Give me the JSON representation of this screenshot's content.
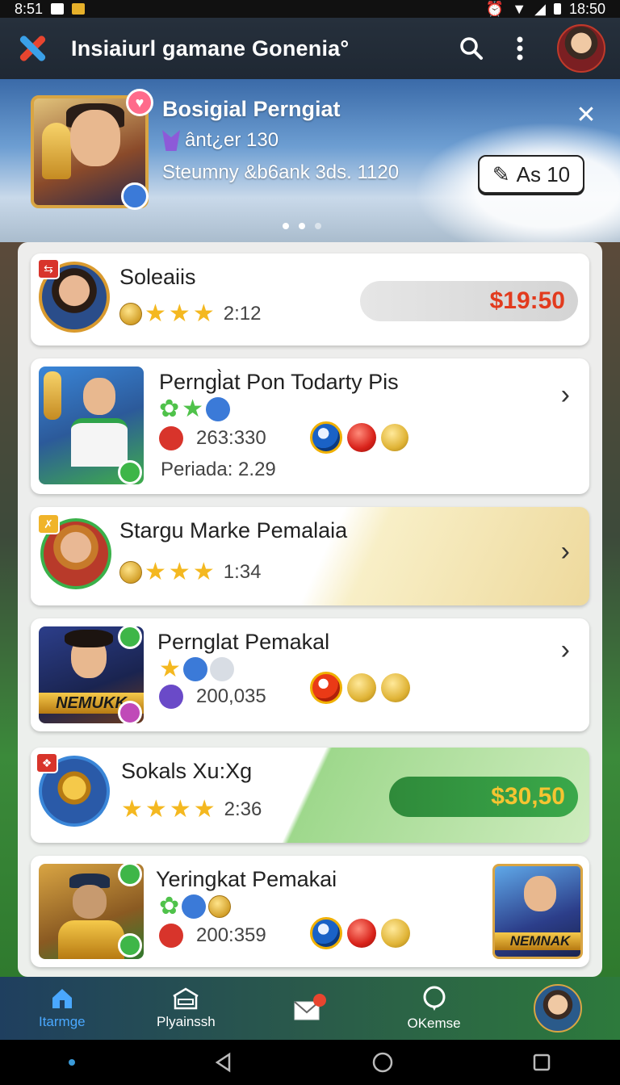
{
  "status": {
    "time_left": "8:51",
    "time_right": "18:50"
  },
  "appbar": {
    "title": "Insiaiurl gamane Gonenia°"
  },
  "hero": {
    "title": "Bosigial Perngiat",
    "subtitle": "ânt¿er 130",
    "meta": "Steumny &b6ank 3ds. 1120",
    "button_label": "As 10",
    "page_count": 3,
    "active_page": 2
  },
  "items": [
    {
      "title": "Soleaiis",
      "time": "2:12",
      "price": "$19:50",
      "price_color": "#e23b1e"
    },
    {
      "title": "Perngl̀at Pon Todarty Pis",
      "stat": "263:330",
      "extra": "Periada: 2.29"
    },
    {
      "title": "Stargu Marke Pemalaia",
      "time": "1:34"
    },
    {
      "title": "Pernglat Pemakal",
      "stat": "200,035",
      "card_text": "NEMUKK"
    },
    {
      "title": "Sokals Xu:Xg",
      "time": "2:36",
      "price": "$30,50",
      "price_color": "#2f8a2f"
    },
    {
      "title": "Yeringkat Pemakai",
      "stat": "200:359",
      "card_text": "NEMNAK"
    }
  ],
  "nav": {
    "items": [
      {
        "label": "Itarmge",
        "icon": "home-icon",
        "active": true
      },
      {
        "label": "Plyainssh",
        "icon": "shop-icon",
        "active": false
      },
      {
        "label": "",
        "icon": "mail-icon",
        "active": false
      },
      {
        "label": "OKemse",
        "icon": "chat-icon",
        "active": false
      },
      {
        "label": "",
        "icon": "profile-avatar",
        "active": false
      }
    ]
  },
  "colors": {
    "accent": "#4aa8ff",
    "gold": "#f4b820",
    "appbar": "#26303c"
  }
}
